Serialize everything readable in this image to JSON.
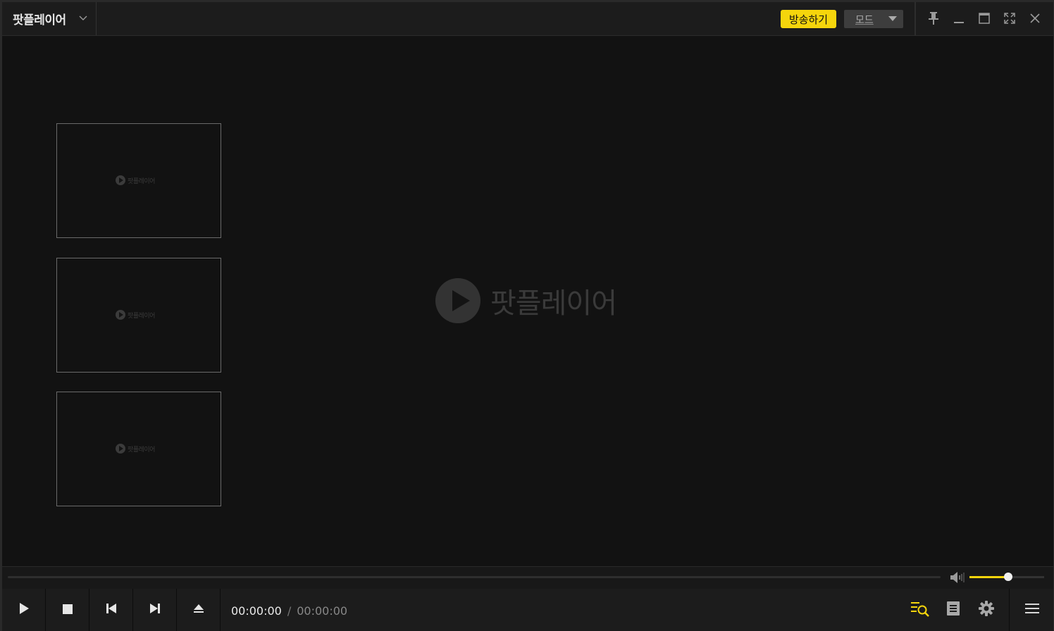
{
  "titlebar": {
    "app_name": "팟플레이어",
    "broadcast_label": "방송하기",
    "mode_label": "모드"
  },
  "video": {
    "logo_text": "팟플레이어",
    "thumbnails": [
      {
        "logo_text": "팟플레이어"
      },
      {
        "logo_text": "팟플레이어"
      },
      {
        "logo_text": "팟플레이어"
      }
    ]
  },
  "playback": {
    "current_time": "00:00:00",
    "separator": "/",
    "total_time": "00:00:00",
    "progress": 0,
    "volume": 0.52
  },
  "colors": {
    "accent": "#f5d50c",
    "background": "#121212",
    "toolbar": "#1c1c1c"
  },
  "icons": {
    "titlebar": [
      "chevron-down-icon",
      "pin-icon",
      "minimize-icon",
      "maximize-icon",
      "fullscreen-icon",
      "close-icon"
    ],
    "controls": [
      "play-icon",
      "stop-icon",
      "previous-icon",
      "next-icon",
      "eject-icon",
      "playlist-search-icon",
      "notes-icon",
      "gear-icon",
      "hamburger-menu-icon",
      "speaker-icon"
    ]
  }
}
